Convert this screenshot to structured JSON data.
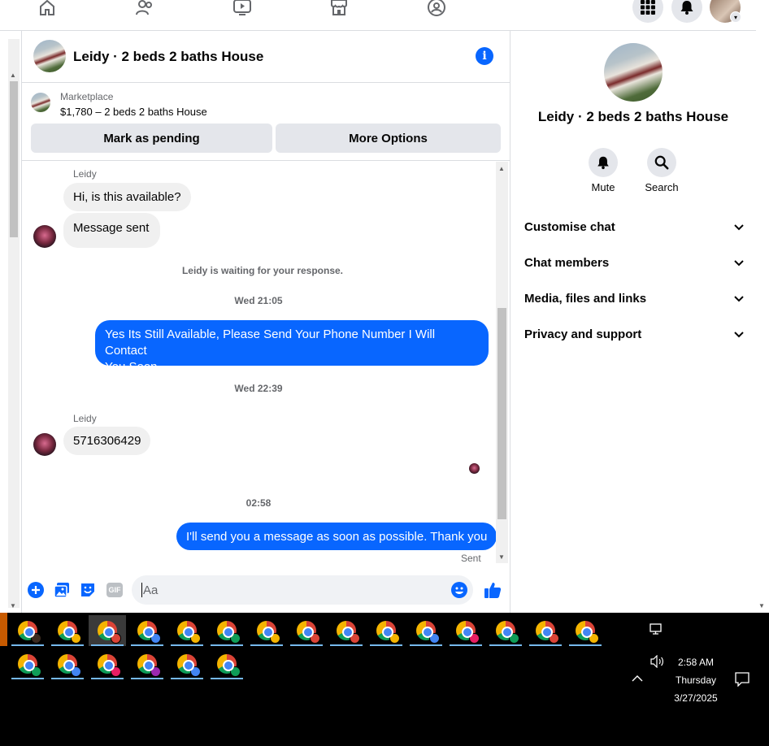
{
  "chat_header": {
    "title": "Leidy · 2 beds 2 baths House"
  },
  "marketplace": {
    "label": "Marketplace",
    "listing": "$1,780 – 2 beds 2 baths House",
    "mark_pending": "Mark as pending",
    "more_options": "More Options"
  },
  "messages": [
    {
      "sender": "Leidy",
      "text": "Hi, is this available?"
    },
    {
      "text": "Message sent"
    },
    {
      "system": "Leidy is waiting for your response."
    },
    {
      "timestamp": "Wed 21:05"
    },
    {
      "outgoing_line1": "Yes Its Still Available, Please Send Your Phone Number I Will Contact",
      "outgoing_line2": "You Soon."
    },
    {
      "timestamp": "Wed 22:39"
    },
    {
      "sender": "Leidy",
      "text": "5716306429"
    },
    {
      "timestamp": "02:58"
    },
    {
      "outgoing": "I'll send you a message as soon as possible. Thank you",
      "status": "Sent"
    }
  ],
  "composer": {
    "placeholder": "Aa",
    "gif_label": "GIF"
  },
  "right_panel": {
    "title": "Leidy · 2 beds 2 baths House",
    "mute_label": "Mute",
    "search_label": "Search",
    "sections": [
      "Customise chat",
      "Chat members",
      "Media, files and links",
      "Privacy and support"
    ]
  },
  "taskbar": {
    "time": "2:58 AM",
    "day": "Thursday",
    "date": "3/27/2025",
    "profile_colors": [
      "#3b2a20",
      "#f4b400",
      "#db4437",
      "#4285f4",
      "#f4b400",
      "#0f9d58",
      "#f4b400",
      "#db4437",
      "#db4437",
      "#f4b400",
      "#4285f4",
      "#e91e63",
      "#0f9d58",
      "#db4437",
      "#f4b400",
      "#0f9d58",
      "#4285f4",
      "#e91e63",
      "#9c27b0",
      "#4285f4",
      "#0f9d58"
    ]
  },
  "colors": {
    "accent": "#0866ff",
    "bubble_in": "#f0f0f0"
  }
}
